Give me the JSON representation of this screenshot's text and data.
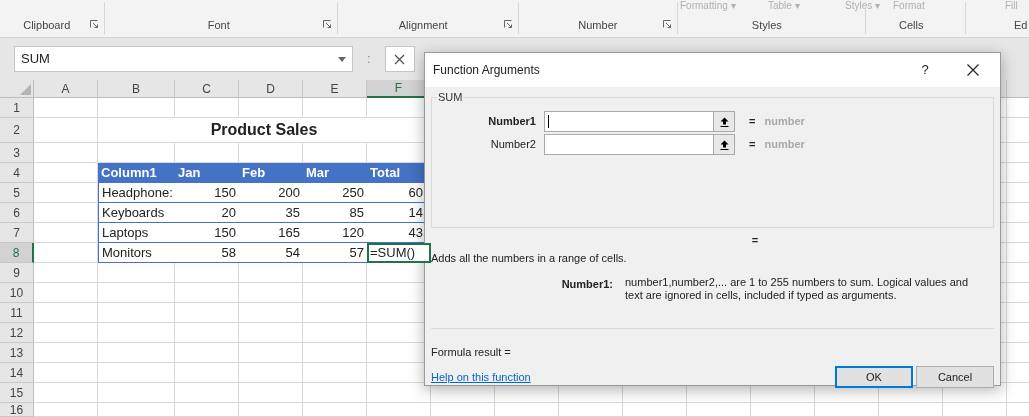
{
  "ribbon": {
    "top_items": [
      {
        "label": "Formatting ▾"
      },
      {
        "label": "Table ▾"
      },
      {
        "label": "Styles ▾"
      },
      {
        "label": "Format"
      },
      {
        "label": "Fill"
      }
    ],
    "groups": [
      {
        "label": "Clipboard",
        "has_launcher": true
      },
      {
        "label": "Font",
        "has_launcher": true
      },
      {
        "label": "Alignment",
        "has_launcher": true
      },
      {
        "label": "Number",
        "has_launcher": true
      },
      {
        "label": "Styles",
        "has_launcher": false
      },
      {
        "label": "Cells",
        "has_launcher": false
      },
      {
        "label": "Ed",
        "has_launcher": false
      }
    ]
  },
  "formula_bar": {
    "name_box": "SUM",
    "separator": ":"
  },
  "sheet": {
    "column_headers": [
      {
        "label": "A",
        "selected": false
      },
      {
        "label": "B",
        "selected": false
      },
      {
        "label": "C",
        "selected": false
      },
      {
        "label": "D",
        "selected": false
      },
      {
        "label": "E",
        "selected": false
      },
      {
        "label": "F",
        "selected": true
      }
    ],
    "row_headers": [
      {
        "label": "1",
        "selected": false
      },
      {
        "label": "2",
        "selected": false
      },
      {
        "label": "3",
        "selected": false
      },
      {
        "label": "4",
        "selected": false
      },
      {
        "label": "5",
        "selected": false
      },
      {
        "label": "6",
        "selected": false
      },
      {
        "label": "7",
        "selected": false
      },
      {
        "label": "8",
        "selected": true
      },
      {
        "label": "9",
        "selected": false
      },
      {
        "label": "10",
        "selected": false
      },
      {
        "label": "11",
        "selected": false
      },
      {
        "label": "12",
        "selected": false
      },
      {
        "label": "13",
        "selected": false
      },
      {
        "label": "14",
        "selected": false
      },
      {
        "label": "15",
        "selected": false
      },
      {
        "label": "16",
        "selected": false
      }
    ],
    "title": "Product Sales",
    "table": {
      "columns": [
        "Column1",
        "Jan",
        "Feb",
        "Mar",
        "Total"
      ],
      "rows": [
        {
          "cells": [
            "Headphone:",
            "150",
            "200",
            "250",
            "60"
          ],
          "editing": false
        },
        {
          "cells": [
            "Keyboards",
            "20",
            "35",
            "85",
            "14"
          ],
          "editing": false
        },
        {
          "cells": [
            "Laptops",
            "150",
            "165",
            "120",
            "43"
          ],
          "editing": false
        },
        {
          "cells": [
            "Monitors",
            "58",
            "54",
            "57",
            "=SUM()"
          ],
          "editing": true
        }
      ]
    }
  },
  "dialog": {
    "title": "Function Arguments",
    "help": "?",
    "function_name": "SUM",
    "arguments": [
      {
        "label": "Number1",
        "selected": true,
        "equals": "=",
        "result": "number"
      },
      {
        "label": "Number2",
        "selected": false,
        "equals": "=",
        "result": "number"
      }
    ],
    "total_equals": "=",
    "description": "Adds all the numbers in a range of cells.",
    "argument_help": {
      "label": "Number1:",
      "text": "number1,number2,... are 1 to 255 numbers to sum. Logical values and text are ignored in cells, included if typed as arguments."
    },
    "formula_result": "Formula result =",
    "help_link": "Help on this function",
    "buttons": [
      {
        "label": "OK",
        "default": true
      },
      {
        "label": "Cancel",
        "default": false
      }
    ]
  }
}
